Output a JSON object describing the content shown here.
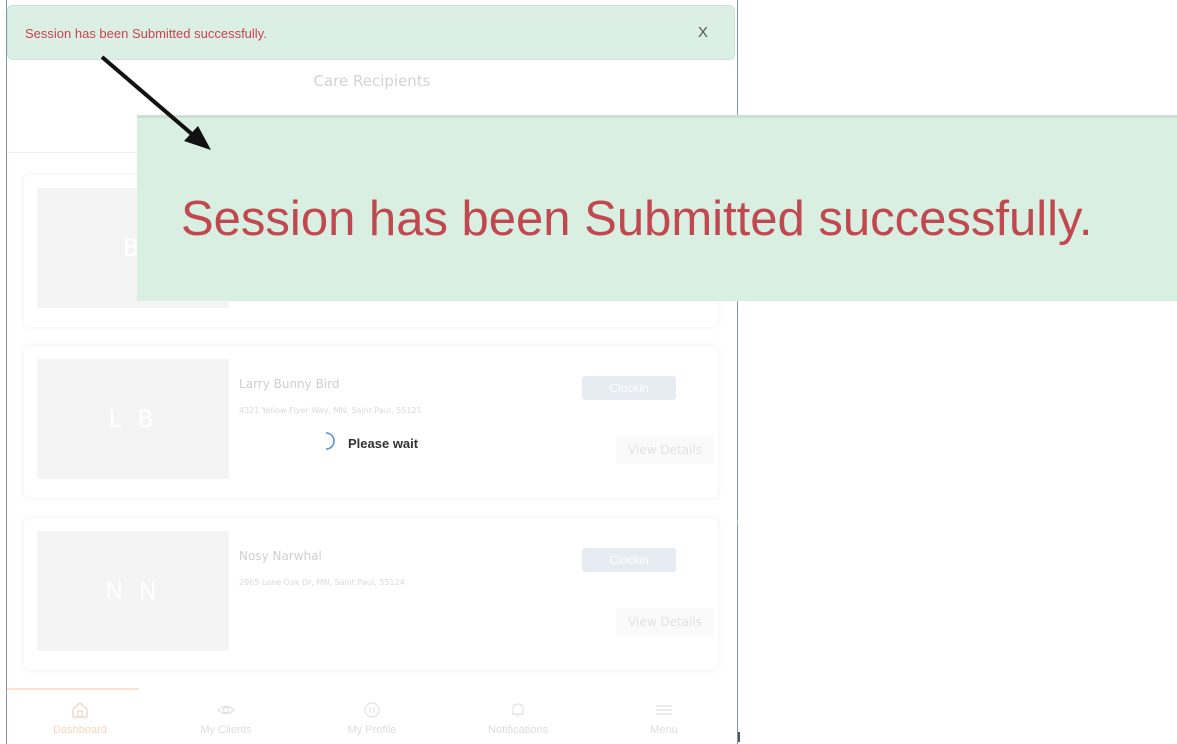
{
  "toast": {
    "message": "Session has been Submitted successfully.",
    "close_label": "X"
  },
  "zoom": {
    "message": "Session has been Submitted successfully."
  },
  "header": {
    "title": "Care Recipients"
  },
  "cards": [
    {
      "initials": "B",
      "name": "",
      "address": "",
      "clockin_label": "",
      "details_label": ""
    },
    {
      "initials": "L B",
      "name": "Larry Bunny Bird",
      "address": "4321 Yellow Flyer Way, MN, Saint Paul, 55121",
      "clockin_label": "Clockin",
      "details_label": "View Details"
    },
    {
      "initials": "N N",
      "name": "Nosy Narwhal",
      "address": "2965 Lone Oak Dr, MN, Saint Paul, 55124",
      "clockin_label": "Clockin",
      "details_label": "View Details"
    }
  ],
  "loading": {
    "text": "Please wait"
  },
  "nav": {
    "items": [
      {
        "label": "Dashboard",
        "icon": "home-icon",
        "active": true
      },
      {
        "label": "My Clients",
        "icon": "eye-icon",
        "active": false
      },
      {
        "label": "My Profile",
        "icon": "profile-icon",
        "active": false
      },
      {
        "label": "Notifications",
        "icon": "bell-icon",
        "active": false
      },
      {
        "label": "Menu",
        "icon": "menu-icon",
        "active": false
      }
    ]
  },
  "colors": {
    "toast_bg": "#dcefe4",
    "toast_text": "#c9434f",
    "active_nav": "#f8d6c0"
  }
}
